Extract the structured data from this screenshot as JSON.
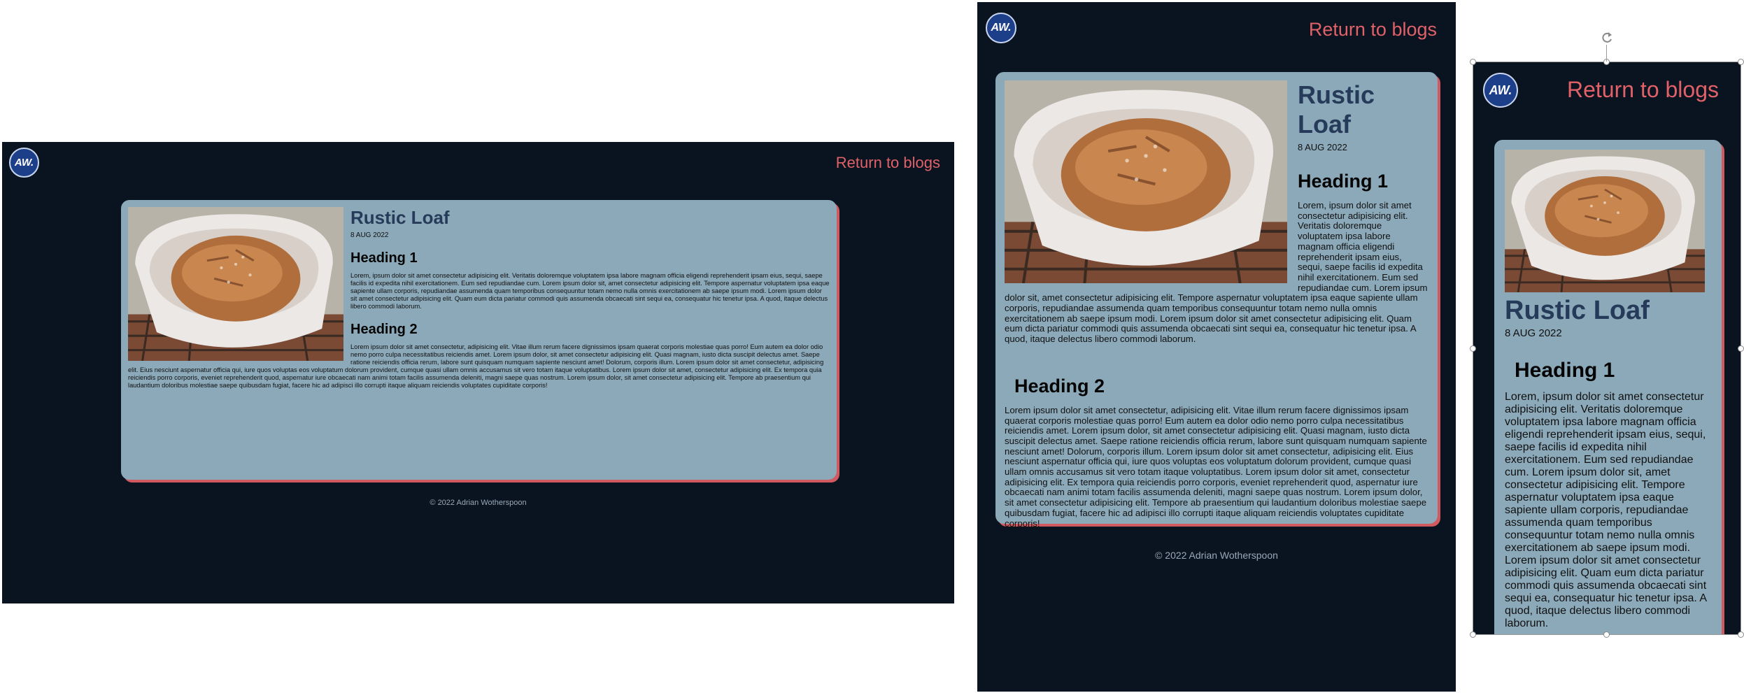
{
  "logo_text": "AW.",
  "return_label": "Return to blogs",
  "post": {
    "title": "Rustic Loaf",
    "date": "8 AUG 2022",
    "heading1": "Heading 1",
    "heading2": "Heading 2",
    "para1": "Lorem, ipsum dolor sit amet consectetur adipisicing elit. Veritatis doloremque voluptatem ipsa labore magnam officia eligendi reprehenderit ipsam eius, sequi, saepe facilis id expedita nihil exercitationem. Eum sed repudiandae cum. Lorem ipsum dolor sit, amet consectetur adipisicing elit. Tempore aspernatur voluptatem ipsa eaque sapiente ullam corporis, repudiandae assumenda quam temporibus consequuntur totam nemo nulla omnis exercitationem ab saepe ipsum modi. Lorem ipsum dolor sit amet consectetur adipisicing elit. Quam eum dicta pariatur commodi quis assumenda obcaecati sint sequi ea, consequatur hic tenetur ipsa. A quod, itaque delectus libero commodi laborum.",
    "para2": "Lorem ipsum dolor sit amet consectetur, adipisicing elit. Vitae illum rerum facere dignissimos ipsam quaerat corporis molestiae quas porro! Eum autem ea dolor odio nemo porro culpa necessitatibus reiciendis amet. Lorem ipsum dolor, sit amet consectetur adipisicing elit. Quasi magnam, iusto dicta suscipit delectus amet. Saepe ratione reiciendis officia rerum, labore sunt quisquam numquam sapiente nesciunt amet! Dolorum, corporis illum. Lorem ipsum dolor sit amet consectetur, adipisicing elit. Eius nesciunt aspernatur officia qui, iure quos voluptas eos voluptatum dolorum provident, cumque quasi ullam omnis accusamus sit vero totam itaque voluptatibus. Lorem ipsum dolor sit amet, consectetur adipisicing elit. Ex tempora quia reiciendis porro corporis, eveniet reprehenderit quod, aspernatur iure obcaecati nam animi totam facilis assumenda deleniti, magni saepe quas nostrum. Lorem ipsum dolor, sit amet consectetur adipisicing elit. Tempore ab praesentium qui laudantium doloribus molestiae saepe quibusdam fugiat, facere hic ad adipisci illo corrupti itaque aliquam reiciendis voluptates cupiditate corporis!"
  },
  "footer": "© 2022 Adrian Wotherspoon",
  "icons": {
    "logo": "monogram-logo",
    "photo": "bread-in-dutch-oven-photo",
    "rotate": "rotate-handle-icon"
  },
  "colors": {
    "background": "#0a1421",
    "card": "#8ca9b9",
    "card_shadow": "#d05a60",
    "link": "#e06167",
    "title": "#263b59"
  }
}
